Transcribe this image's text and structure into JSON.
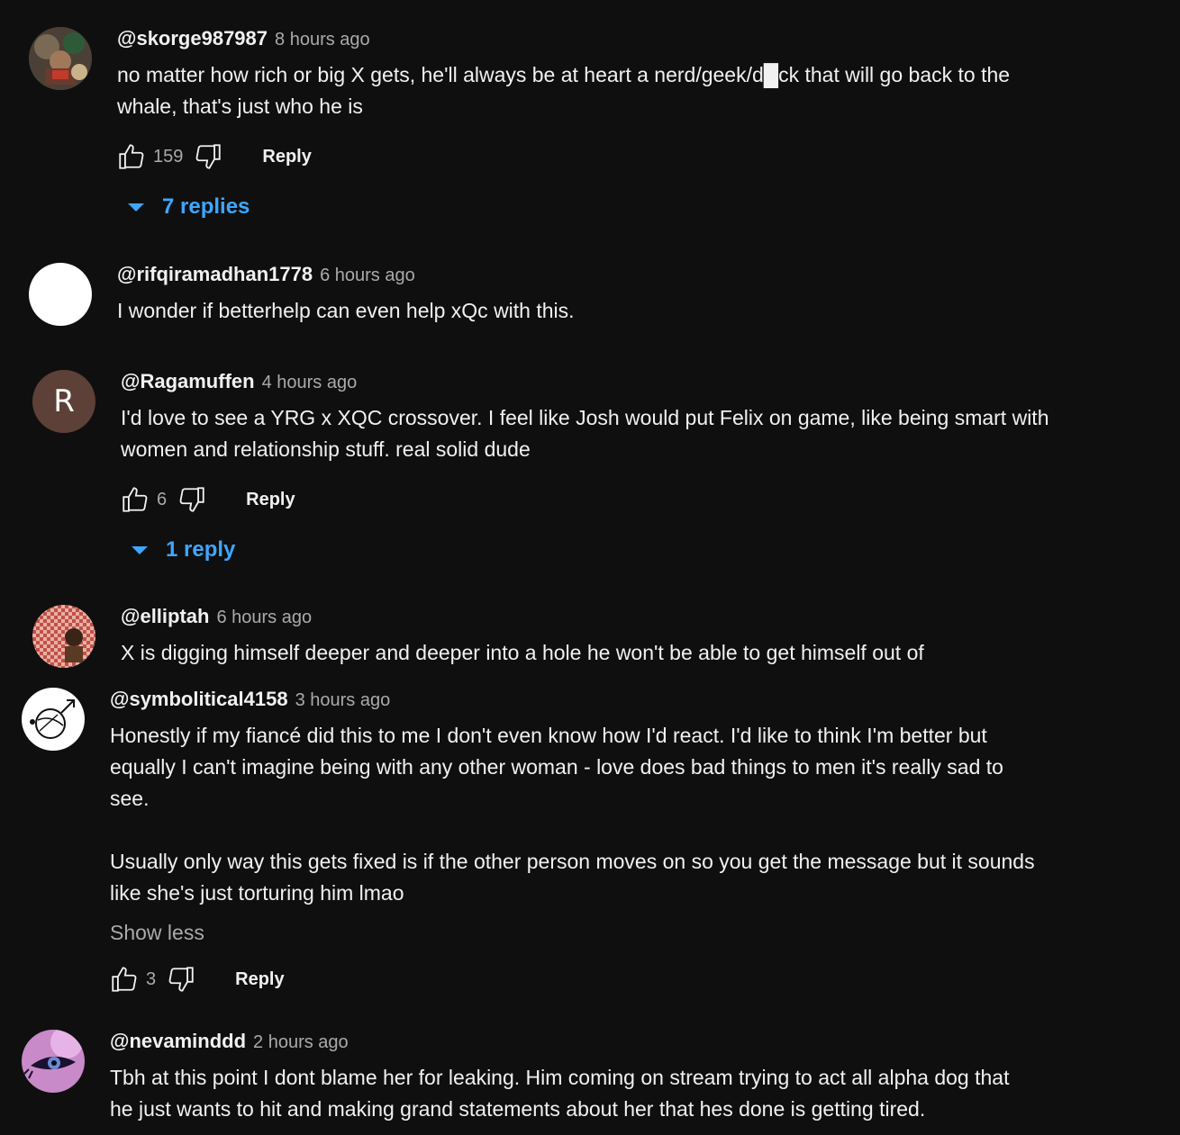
{
  "comments": [
    {
      "author": "@skorge987987",
      "time": "8 hours ago",
      "text": "no matter how rich or big X gets, he'll always be at heart a nerd/geek/d█ck that will go back to the\nwhale, that's just who he is",
      "likes": "159",
      "reply_label": "Reply",
      "replies_label": "7 replies",
      "avatar_icon": "photo-avatar-icon"
    },
    {
      "author": "@rifqiramadhan1778",
      "time": "6 hours ago",
      "text": "I wonder if betterhelp can even help xQc with this.",
      "avatar_icon": "blank-avatar-icon"
    },
    {
      "author": "@Ragamuffen",
      "time": "4 hours ago",
      "text": "I'd love to see a YRG x XQC crossover. I feel like Josh would put Felix on game, like being smart with\nwomen and relationship stuff. real solid dude",
      "likes": "6",
      "reply_label": "Reply",
      "replies_label": "1 reply",
      "avatar_letter": "R",
      "avatar_color": "#5d4037"
    },
    {
      "author": "@elliptah",
      "time": "6 hours ago",
      "text": "X is digging himself deeper and deeper into a hole he won't be able to get himself out of",
      "avatar_icon": "checkered-avatar-icon"
    },
    {
      "author": "@symbolitical4158",
      "time": "3 hours ago",
      "text": "Honestly if my fiancé did this to me I don't even know how I'd react. I'd like to think I'm better but\nequally I can't imagine being with any other woman - love does bad things to men it's really sad to\nsee.\n\nUsually only way this gets fixed is if the other person moves on so you get the message but it sounds\nlike she's just torturing him lmao",
      "show_less": "Show less",
      "likes": "3",
      "reply_label": "Reply",
      "avatar_icon": "symbol-avatar-icon"
    },
    {
      "author": "@nevaminddd",
      "time": "2 hours ago",
      "text": "Tbh at this point I dont blame her for leaking. Him coming on stream trying to act all alpha dog that\nhe just wants to hit and making grand statements about her that hes done is getting tired.",
      "avatar_icon": "eye-avatar-icon"
    }
  ],
  "colors": {
    "background": "#0f0f0f",
    "text": "#f1f1f1",
    "secondary": "#aaaaaa",
    "link": "#3ea6ff"
  }
}
